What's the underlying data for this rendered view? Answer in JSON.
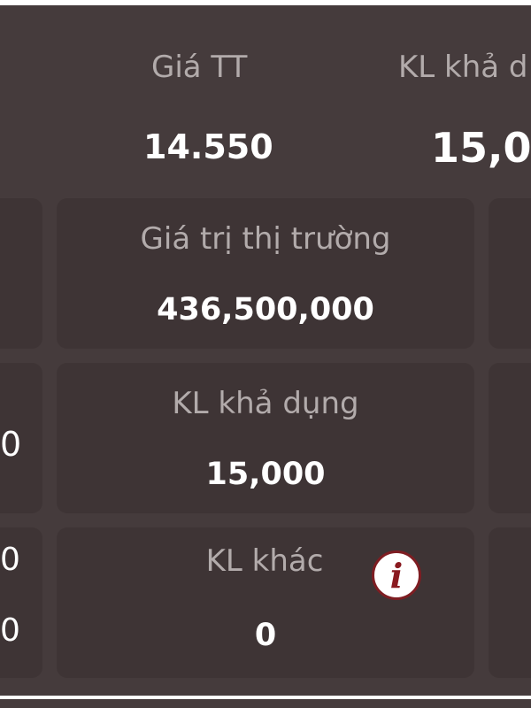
{
  "header": {
    "price_label": "Giá TT",
    "price_value": "14.550",
    "available_label_partial": "KL khả d",
    "available_value_partial": "15,00"
  },
  "cards": {
    "market_value": {
      "label": "Giá trị thị trường",
      "value": "436,500,000"
    },
    "available_qty": {
      "label": "KL khả dụng",
      "value": "15,000"
    },
    "other_qty": {
      "label": "KL khác",
      "value": "0",
      "info_icon": "info-icon",
      "info_glyph": "i"
    }
  },
  "left_column_values": {
    "row2": "0",
    "row3_top": "0",
    "row3_bottom": "0"
  },
  "colors": {
    "background": "#453b3c",
    "card": "#3e3435",
    "label": "#b2abab",
    "value": "#ffffff",
    "info_accent": "#8a1a20"
  }
}
